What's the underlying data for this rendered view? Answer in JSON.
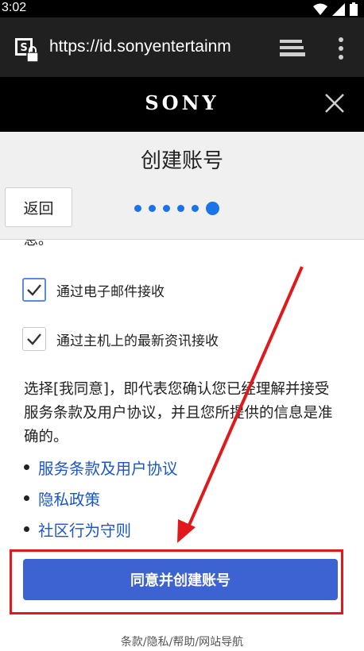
{
  "statusbar": {
    "time": "3:02"
  },
  "browser": {
    "url": "https://id.sonyentertainm"
  },
  "brand": {
    "logo": "SONY"
  },
  "header": {
    "title": "创建账号",
    "back_label": "返回",
    "progress_steps": 6,
    "current_step": 6
  },
  "content": {
    "cut_text": "息。",
    "options": [
      {
        "label": "通过电子邮件接收",
        "checked": true
      },
      {
        "label": "通过主机上的最新资讯接收",
        "checked": true
      }
    ],
    "agree_text": "选择[我同意]，即代表您确认您已经理解并接受服务条款及用户协议，并且您所提供的信息是准确的。",
    "links": [
      "服务条款及用户协议",
      "隐私政策",
      "社区行为守则"
    ],
    "agree_button": "同意并创建账号"
  },
  "footer": {
    "text": "条款/隐私/帮助/网站导航"
  },
  "colors": {
    "primary": "#3d63d2",
    "link": "#1a56c6",
    "annotation": "#e0191c",
    "progress": "#1a73e8"
  },
  "icons": [
    "wifi-icon",
    "signal-icon",
    "battery-icon",
    "site-lock-icon",
    "tabs-icon",
    "menu-icon",
    "close-icon",
    "checkmark-icon"
  ]
}
